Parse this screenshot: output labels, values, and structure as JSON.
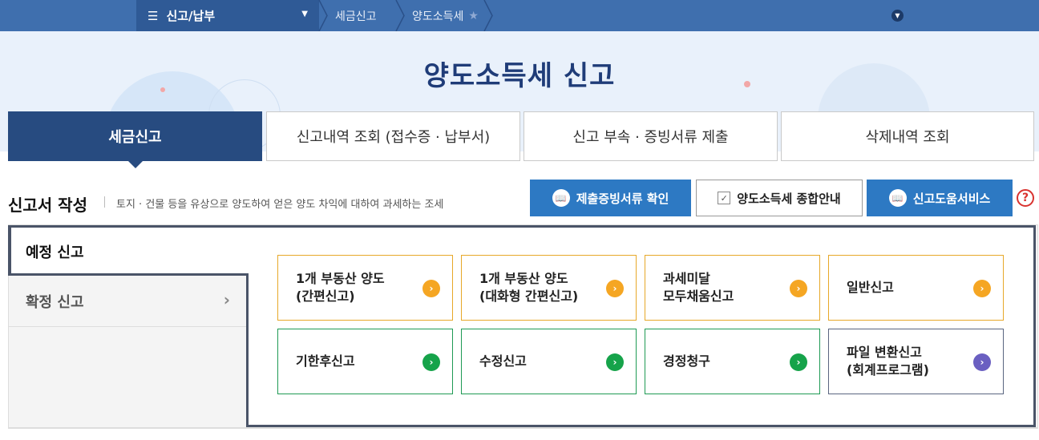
{
  "nav": {
    "menu_label": "신고/납부",
    "breadcrumbs": [
      "세금신고",
      "양도소득세"
    ]
  },
  "hero": {
    "title": "양도소득세  신고"
  },
  "tabs": [
    {
      "label": "세금신고",
      "active": true
    },
    {
      "label": "신고내역 조회 (접수증 · 납부서)",
      "active": false
    },
    {
      "label": "신고 부속 · 증빙서류 제출",
      "active": false
    },
    {
      "label": "삭제내역 조회",
      "active": false
    }
  ],
  "section": {
    "title": "신고서 작성",
    "description": "토지 · 건물 등을 유상으로 양도하여 얻은 양도 차익에 대하여 과세하는 조세"
  },
  "actions": {
    "doc_check": "제출증빙서류 확인",
    "guide": "양도소득세 종합안내",
    "help_service": "신고도움서비스",
    "help_icon": "?"
  },
  "side": {
    "items": [
      "예정 신고",
      "확정 신고"
    ]
  },
  "cards": [
    {
      "label": "1개 부동산 양도\n(간편신고)",
      "color": "orange"
    },
    {
      "label": "1개 부동산 양도\n(대화형 간편신고)",
      "color": "orange"
    },
    {
      "label": "과세미달\n모두채움신고",
      "color": "orange"
    },
    {
      "label": "일반신고",
      "color": "orange"
    },
    {
      "label": "기한후신고",
      "color": "green"
    },
    {
      "label": "수정신고",
      "color": "green"
    },
    {
      "label": "경정청구",
      "color": "green"
    },
    {
      "label": "파일 변환신고\n(회계프로그램)",
      "color": "navy"
    }
  ],
  "colors": {
    "nav_bg": "#3f6fae",
    "active_tab": "#274b80",
    "action_blue": "#2d79c3",
    "orange": "#f5a623",
    "green": "#16a34a",
    "navy": "#6a5fc1"
  }
}
